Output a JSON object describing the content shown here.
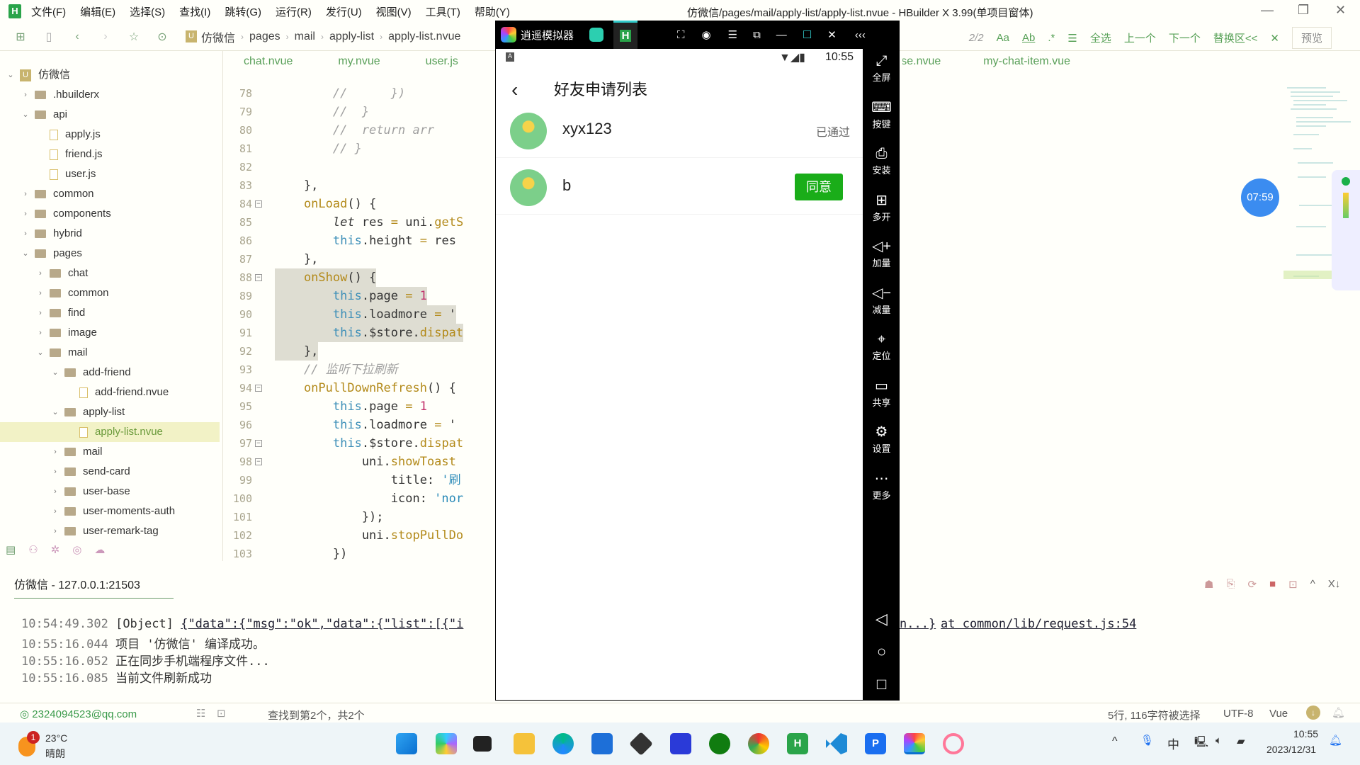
{
  "menu": {
    "items": [
      "文件(F)",
      "编辑(E)",
      "选择(S)",
      "查找(I)",
      "跳转(G)",
      "运行(R)",
      "发行(U)",
      "视图(V)",
      "工具(T)",
      "帮助(Y)"
    ]
  },
  "window": {
    "title": "仿微信/pages/mail/apply-list/apply-list.nvue - HBuilder X 3.99(单项目窗体)"
  },
  "breadcrumb": [
    "仿微信",
    "pages",
    "mail",
    "apply-list",
    "apply-list.nvue"
  ],
  "find": {
    "count": "2/2",
    "select_all": "全选",
    "prev": "上一个",
    "next": "下一个",
    "replace": "替换区<<",
    "preview": "预览"
  },
  "tree": [
    {
      "label": "仿微信",
      "level": 0,
      "type": "project",
      "open": true
    },
    {
      "label": ".hbuilderx",
      "level": 1,
      "type": "folder"
    },
    {
      "label": "api",
      "level": 1,
      "type": "folder",
      "open": true
    },
    {
      "label": "apply.js",
      "level": 2,
      "type": "file"
    },
    {
      "label": "friend.js",
      "level": 2,
      "type": "file"
    },
    {
      "label": "user.js",
      "level": 2,
      "type": "file"
    },
    {
      "label": "common",
      "level": 1,
      "type": "folder"
    },
    {
      "label": "components",
      "level": 1,
      "type": "folder"
    },
    {
      "label": "hybrid",
      "level": 1,
      "type": "folder"
    },
    {
      "label": "pages",
      "level": 1,
      "type": "folder",
      "open": true
    },
    {
      "label": "chat",
      "level": 2,
      "type": "folder"
    },
    {
      "label": "common",
      "level": 2,
      "type": "folder"
    },
    {
      "label": "find",
      "level": 2,
      "type": "folder"
    },
    {
      "label": "image",
      "level": 2,
      "type": "folder"
    },
    {
      "label": "mail",
      "level": 2,
      "type": "folder",
      "open": true
    },
    {
      "label": "add-friend",
      "level": 3,
      "type": "folder",
      "open": true
    },
    {
      "label": "add-friend.nvue",
      "level": 4,
      "type": "file"
    },
    {
      "label": "apply-list",
      "level": 3,
      "type": "folder",
      "open": true
    },
    {
      "label": "apply-list.nvue",
      "level": 4,
      "type": "file",
      "selected": true
    },
    {
      "label": "mail",
      "level": 3,
      "type": "folder"
    },
    {
      "label": "send-card",
      "level": 3,
      "type": "folder"
    },
    {
      "label": "user-base",
      "level": 3,
      "type": "folder"
    },
    {
      "label": "user-moments-auth",
      "level": 3,
      "type": "folder"
    },
    {
      "label": "user-remark-tag",
      "level": 3,
      "type": "folder"
    }
  ],
  "tabs": [
    "chat.nvue",
    "my.nvue",
    "user.js",
    "user-base.nvue",
    "my-chat-item.vue"
  ],
  "code": [
    {
      "n": "78",
      "s": [
        [
          "cm",
          "        //      })"
        ]
      ]
    },
    {
      "n": "79",
      "s": [
        [
          "cm",
          "        //  }"
        ]
      ]
    },
    {
      "n": "80",
      "s": [
        [
          "cm",
          "        //  return arr"
        ]
      ]
    },
    {
      "n": "81",
      "s": [
        [
          "cm",
          "        // }"
        ]
      ]
    },
    {
      "n": "82",
      "s": []
    },
    {
      "n": "83",
      "s": [
        [
          "",
          "    },"
        ]
      ]
    },
    {
      "n": "84",
      "f": true,
      "s": [
        [
          "fn",
          "    onLoad"
        ],
        [
          "",
          "() {"
        ]
      ]
    },
    {
      "n": "85",
      "s": [
        [
          "",
          "        "
        ],
        [
          "let",
          "let"
        ],
        [
          "",
          " res "
        ],
        [
          "op",
          "="
        ],
        [
          "",
          " uni."
        ],
        [
          "fn",
          "getS"
        ]
      ]
    },
    {
      "n": "86",
      "s": [
        [
          "",
          "        "
        ],
        [
          "kw",
          "this"
        ],
        [
          "",
          ".height "
        ],
        [
          "op",
          "="
        ],
        [
          "",
          " res"
        ]
      ]
    },
    {
      "n": "87",
      "s": [
        [
          "",
          "    },"
        ]
      ]
    },
    {
      "n": "88",
      "f": true,
      "h": true,
      "s": [
        [
          "fn",
          "    onShow"
        ],
        [
          "",
          "() {"
        ]
      ]
    },
    {
      "n": "89",
      "h": true,
      "s": [
        [
          "",
          "        "
        ],
        [
          "kw",
          "this"
        ],
        [
          "",
          ".page "
        ],
        [
          "op",
          "="
        ],
        [
          "num",
          " 1"
        ]
      ]
    },
    {
      "n": "90",
      "h": true,
      "s": [
        [
          "",
          "        "
        ],
        [
          "kw",
          "this"
        ],
        [
          "",
          ".loadmore "
        ],
        [
          "op",
          "="
        ],
        [
          "",
          " '"
        ]
      ]
    },
    {
      "n": "91",
      "h": true,
      "s": [
        [
          "",
          "        "
        ],
        [
          "kw",
          "this"
        ],
        [
          "",
          ".$store."
        ],
        [
          "fn",
          "dispat"
        ]
      ]
    },
    {
      "n": "92",
      "h": true,
      "s": [
        [
          "",
          "    },"
        ]
      ]
    },
    {
      "n": "93",
      "s": [
        [
          "cm",
          "    // 监听下拉刷新"
        ]
      ]
    },
    {
      "n": "94",
      "f": true,
      "s": [
        [
          "fn",
          "    onPullDownRefresh"
        ],
        [
          "",
          "() {"
        ]
      ]
    },
    {
      "n": "95",
      "s": [
        [
          "",
          "        "
        ],
        [
          "kw",
          "this"
        ],
        [
          "",
          ".page "
        ],
        [
          "op",
          "="
        ],
        [
          "num",
          " 1"
        ]
      ]
    },
    {
      "n": "96",
      "s": [
        [
          "",
          "        "
        ],
        [
          "kw",
          "this"
        ],
        [
          "",
          ".loadmore "
        ],
        [
          "op",
          "="
        ],
        [
          "",
          " '"
        ]
      ]
    },
    {
      "n": "97",
      "f": true,
      "s": [
        [
          "",
          "        "
        ],
        [
          "kw",
          "this"
        ],
        [
          "",
          ".$store."
        ],
        [
          "fn",
          "dispat"
        ]
      ]
    },
    {
      "n": "98",
      "f": true,
      "s": [
        [
          "",
          "            uni."
        ],
        [
          "fn",
          "showToast"
        ]
      ]
    },
    {
      "n": "99",
      "s": [
        [
          "",
          "                title: "
        ],
        [
          "str",
          "'刷"
        ]
      ]
    },
    {
      "n": "100",
      "s": [
        [
          "",
          "                icon: "
        ],
        [
          "str",
          "'nor"
        ]
      ]
    },
    {
      "n": "101",
      "s": [
        [
          "",
          "            });"
        ]
      ]
    },
    {
      "n": "102",
      "s": [
        [
          "",
          "            uni."
        ],
        [
          "fn",
          "stopPullDo"
        ]
      ]
    },
    {
      "n": "103",
      "s": [
        [
          "",
          "        })"
        ]
      ]
    }
  ],
  "emulator": {
    "title": "逍遥模拟器",
    "time": "10:55",
    "page_title": "好友申请列表",
    "requests": [
      {
        "name": "xyx123",
        "status": "已通过",
        "action": null
      },
      {
        "name": "b",
        "status": null,
        "action": "同意"
      }
    ],
    "side": [
      "全屏",
      "按键",
      "安装",
      "多开",
      "加量",
      "减量",
      "定位",
      "共享",
      "设置",
      "更多"
    ],
    "accent": "#1aad19"
  },
  "floating_timer": "07:59",
  "console": {
    "tab": "仿微信 - 127.0.0.1:21503",
    "logs": [
      {
        "time": "10:54:49.302",
        "text": "[Object] ",
        "link": "{\"data\":{\"msg\":\"ok\",\"data\":{\"list\":[{\"i",
        "tail": "n...}",
        "at": "at common/lib/request.js:54"
      },
      {
        "time": "10:55:16.044",
        "text": "项目 '仿微信' 编译成功。"
      },
      {
        "time": "10:55:16.052",
        "text": "正在同步手机端程序文件..."
      },
      {
        "time": "10:55:16.085",
        "text": "当前文件刷新成功"
      }
    ]
  },
  "status": {
    "account": "2324094523@qq.com",
    "find": "查找到第2个，共2个",
    "selection": "5行, 116字符被选择",
    "encoding": "UTF-8",
    "lang": "Vue"
  },
  "taskbar": {
    "temp": "23°C",
    "weather": "晴朗",
    "badge": "1",
    "ime": "中",
    "time": "10:55",
    "date": "2023/12/31"
  }
}
